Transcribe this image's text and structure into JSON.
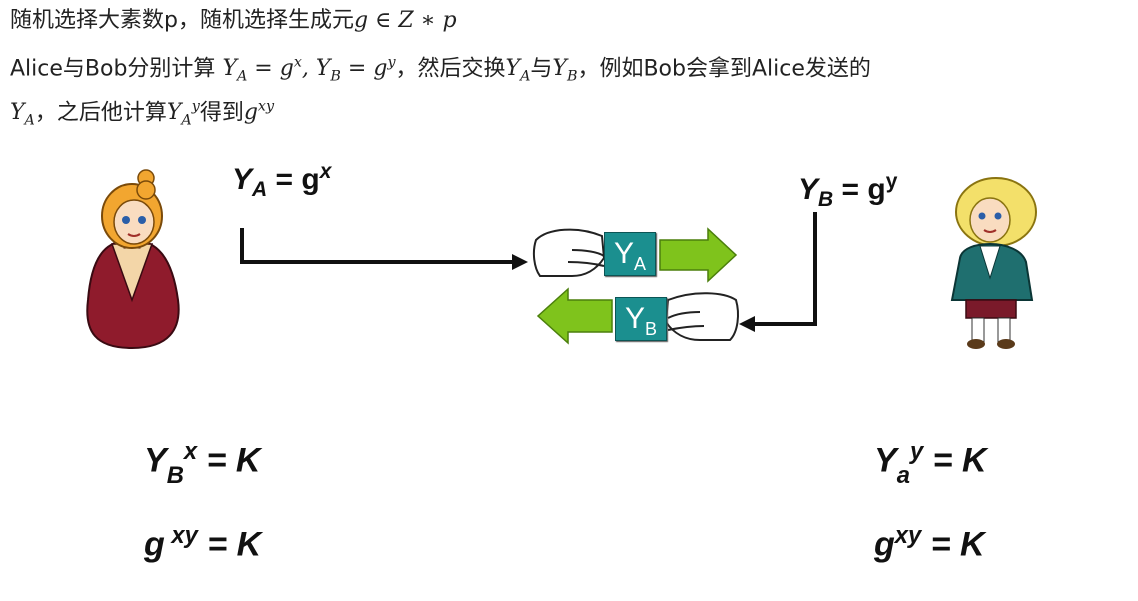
{
  "text": {
    "line1_prefix": "随机选择大素数p，随机选择生成元",
    "line1_math": "g ∈ Z ∗ p",
    "line2_prefix": "Alice与Bob分别计算",
    "line2_mid": "，然后交换",
    "line2_with": "与",
    "line2_suffix": "，例如Bob会拿到Alice发送的",
    "line3_mid": "，之后他计算",
    "line3_suffix": "得到"
  },
  "diagram": {
    "alice_label": "Y",
    "bob_label": "Y",
    "eq_g": "= g",
    "card_letter": "Y",
    "alice_k_1": "= K",
    "alice_k_2": "= K",
    "bob_k_1": "= K",
    "bob_k_2": "= K"
  },
  "colors": {
    "card_teal": "#1b8f8f",
    "arrow_green": "#7fc31c",
    "alice_dress": "#8f1b2c",
    "bob_coat": "#1f6f6f"
  }
}
